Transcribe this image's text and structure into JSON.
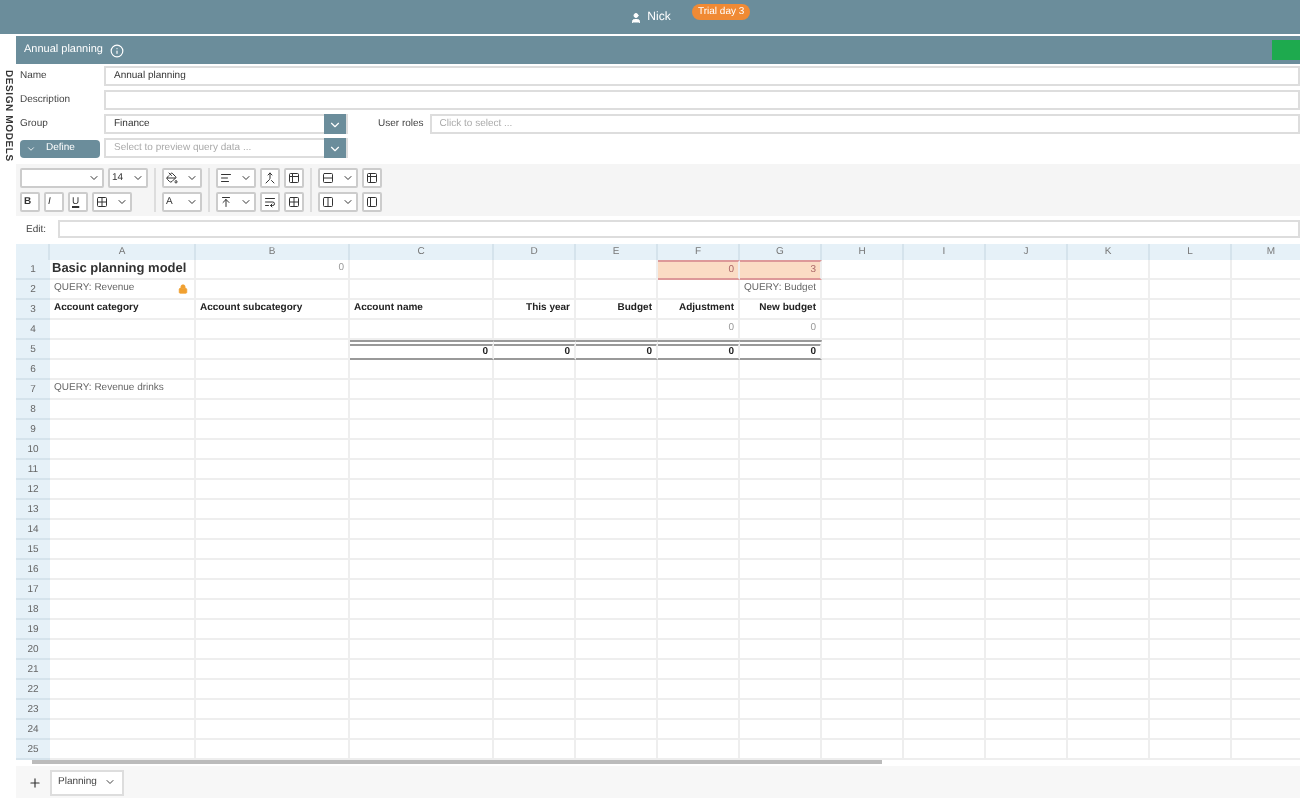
{
  "top_bar": {
    "user": "Nick",
    "badge": "Trial day 3"
  },
  "side_tab": "DESIGN MODELS",
  "header": {
    "title": "Annual planning"
  },
  "form": {
    "name_label": "Name",
    "name_value": "Annual planning",
    "description_label": "Description",
    "group_label": "Group",
    "group_value": "Finance",
    "user_roles_label": "User roles",
    "user_roles_placeholder": "Click to select ...",
    "define_label": "Define",
    "preview_placeholder": "Select to preview query data ..."
  },
  "toolbar": {
    "font_size": "14",
    "bold": "B",
    "italic": "I",
    "underline": "U",
    "font_color": "A"
  },
  "edit": {
    "label": "Edit:"
  },
  "sheet": {
    "columns": [
      "A",
      "B",
      "C",
      "D",
      "E",
      "F",
      "G",
      "H",
      "I",
      "J",
      "K",
      "L",
      "M"
    ],
    "rows": [
      {
        "number": "1",
        "cells": {
          "A": {
            "text": "Basic planning model",
            "kind": "title"
          },
          "B": {
            "text": "0",
            "kind": "muted"
          },
          "F": {
            "text": "0",
            "kind": "highlight"
          },
          "G": {
            "text": "3",
            "kind": "highlight"
          }
        }
      },
      {
        "number": "2",
        "cells": {
          "A": {
            "text": "QUERY: Revenue",
            "kind": "query",
            "locked": true
          },
          "G": {
            "text": "QUERY: Budget",
            "kind": "query_right"
          }
        }
      },
      {
        "number": "3",
        "cells": {
          "A": {
            "text": "Account category",
            "kind": "header"
          },
          "B": {
            "text": "Account subcategory",
            "kind": "header"
          },
          "C": {
            "text": "Account name",
            "kind": "header"
          },
          "D": {
            "text": "This year",
            "kind": "header_right"
          },
          "E": {
            "text": "Budget",
            "kind": "header_right"
          },
          "F": {
            "text": "Adjustment",
            "kind": "header_right"
          },
          "G": {
            "text": "New budget",
            "kind": "header_right"
          }
        }
      },
      {
        "number": "4",
        "cells": {
          "F": {
            "text": "0",
            "kind": "muted"
          },
          "G": {
            "text": "0",
            "kind": "muted"
          }
        }
      },
      {
        "number": "5",
        "cells": {
          "C": {
            "text": "0",
            "kind": "total"
          },
          "D": {
            "text": "0",
            "kind": "total"
          },
          "E": {
            "text": "0",
            "kind": "total"
          },
          "F": {
            "text": "0",
            "kind": "total"
          },
          "G": {
            "text": "0",
            "kind": "total"
          }
        }
      },
      {
        "number": "6"
      },
      {
        "number": "7",
        "cells": {
          "A": {
            "text": "QUERY: Revenue drinks",
            "kind": "query"
          }
        }
      },
      {
        "number": "8"
      },
      {
        "number": "9"
      },
      {
        "number": "10"
      },
      {
        "number": "11"
      },
      {
        "number": "12"
      },
      {
        "number": "13"
      },
      {
        "number": "14"
      },
      {
        "number": "15"
      },
      {
        "number": "16"
      },
      {
        "number": "17"
      },
      {
        "number": "18"
      },
      {
        "number": "19"
      },
      {
        "number": "20"
      },
      {
        "number": "21"
      },
      {
        "number": "22"
      },
      {
        "number": "23"
      },
      {
        "number": "24"
      },
      {
        "number": "25"
      }
    ]
  },
  "sheet_tabs": [
    {
      "label": "Planning",
      "selected": true
    }
  ]
}
